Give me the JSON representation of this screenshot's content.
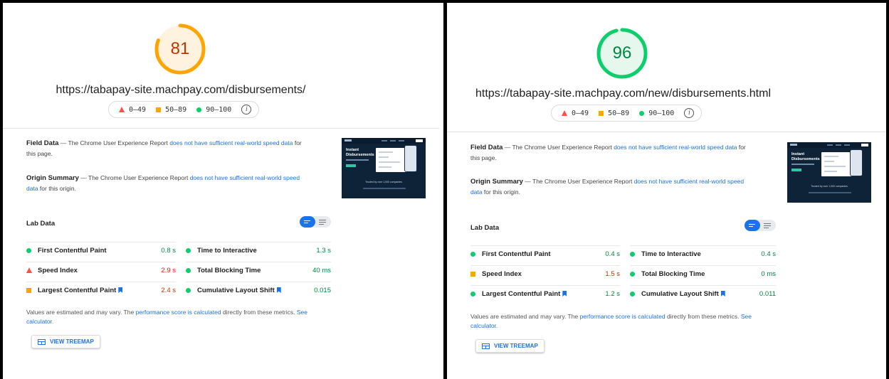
{
  "panels": {
    "left": {
      "score": "81",
      "score_fraction": 0.81,
      "score_color": "#ffa400",
      "score_bg": "#fff3e0",
      "score_text_color": "#c33300",
      "url": "https://tabapay-site.machpay.com/disbursements/",
      "metrics": {
        "fcp": {
          "name": "First Contentful Paint",
          "value": "0.8 s",
          "rating": "good"
        },
        "si": {
          "name": "Speed Index",
          "value": "2.9 s",
          "rating": "poor"
        },
        "lcp": {
          "name": "Largest Contentful Paint",
          "value": "2.4 s",
          "rating": "average"
        },
        "tti": {
          "name": "Time to Interactive",
          "value": "1.3 s",
          "rating": "good"
        },
        "tbt": {
          "name": "Total Blocking Time",
          "value": "40 ms",
          "rating": "good"
        },
        "cls": {
          "name": "Cumulative Layout Shift",
          "value": "0.015",
          "rating": "good"
        }
      }
    },
    "right": {
      "score": "96",
      "score_fraction": 0.96,
      "score_color": "#0cce6b",
      "score_bg": "#e6f8ee",
      "score_text_color": "#018642",
      "url": "https://tabapay-site.machpay.com/new/disbursements.html",
      "metrics": {
        "fcp": {
          "name": "First Contentful Paint",
          "value": "0.4 s",
          "rating": "good"
        },
        "si": {
          "name": "Speed Index",
          "value": "1.5 s",
          "rating": "average"
        },
        "lcp": {
          "name": "Largest Contentful Paint",
          "value": "1.2 s",
          "rating": "good"
        },
        "tti": {
          "name": "Time to Interactive",
          "value": "0.4 s",
          "rating": "good"
        },
        "tbt": {
          "name": "Total Blocking Time",
          "value": "0 ms",
          "rating": "good"
        },
        "cls": {
          "name": "Cumulative Layout Shift",
          "value": "0.011",
          "rating": "good"
        }
      }
    }
  },
  "legend": {
    "poor": "0–49",
    "average": "50–89",
    "good": "90–100",
    "info": "i"
  },
  "field_data": {
    "title": "Field Data",
    "dash": "—",
    "text_before": "The Chrome User Experience Report",
    "link": "does not have sufficient real-world speed data",
    "text_after": "for this page."
  },
  "origin_summary": {
    "title": "Origin Summary",
    "dash": "—",
    "text_before": "The Chrome User Experience Report",
    "link": "does not have sufficient real-world speed data",
    "text_after": "for this origin."
  },
  "thumbnail": {
    "headline_1": "Instant",
    "headline_2": "Disbursements",
    "trusted": "Trusted by over 1,000 companies"
  },
  "lab_data": {
    "title": "Lab Data"
  },
  "note": {
    "text_1": "Values are estimated and may vary. The",
    "link_1": "performance score is calculated",
    "text_2": "directly from these metrics.",
    "link_2": "See calculator."
  },
  "treemap_button": "VIEW TREEMAP",
  "colors": {
    "good": "#0cce6b",
    "average": "#ffa400",
    "poor": "#ff4e42",
    "link": "#1a73e8"
  }
}
